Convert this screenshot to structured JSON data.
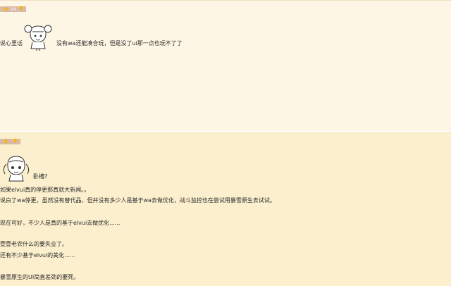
{
  "post1": {
    "vote_count": "24",
    "text_left": "说心里话",
    "text_right": "没有wa还能凑合玩，但是没了ui那一点也玩不了了",
    "emoticon": "girl-emoticon"
  },
  "post2": {
    "vote_count": "",
    "emoticon": "girl-emoticon",
    "lines": [
      "卧槽?",
      "如果elvui真的停更那真就大新闻。。",
      "说白了wa停更，虽然没有替代品，但并没有多少人是基于wa去做优化，战斗监控也在尝试用暴雪原生去试试。",
      "现在可好，不少人是真的基于elvui去做优化......",
      "壹壹老农什么的要失业了。",
      "还有不少基于elvui的美化......",
      "暴雪原生的UI简直差劲的要死。"
    ]
  }
}
